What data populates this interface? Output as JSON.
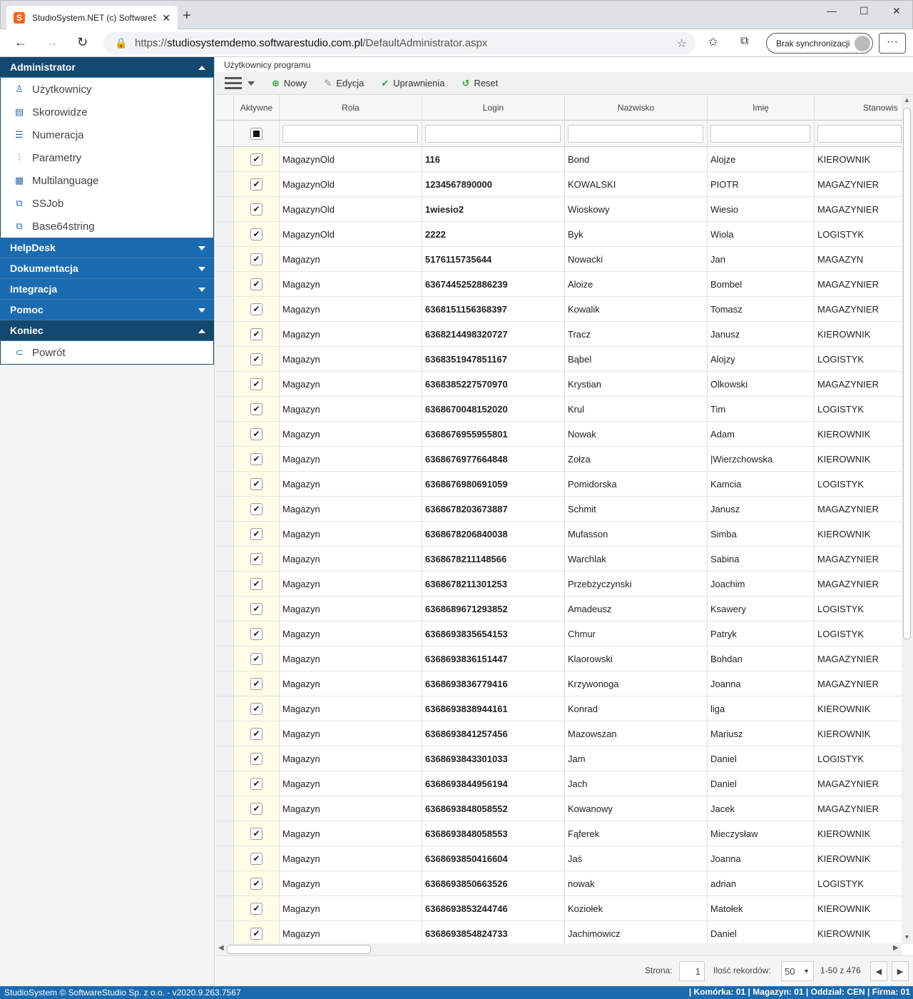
{
  "browser": {
    "tab_title": "StudioSystem.NET (c) SoftwareSt",
    "url_prefix": "https://",
    "url_host": "studiosystemdemo.softwarestudio.com.pl",
    "url_path": "/DefaultAdministrator.aspx",
    "sync_label": "Brak synchronizacji",
    "more_label": "···"
  },
  "sidebar": {
    "admin_label": "Administrator",
    "items": [
      {
        "label": "Użytkownicy",
        "icon": "user-icon",
        "glyph": "♙"
      },
      {
        "label": "Skorowidze",
        "icon": "book-icon",
        "glyph": "▤"
      },
      {
        "label": "Numeracja",
        "icon": "list-icon",
        "glyph": "☰"
      },
      {
        "label": "Parametry",
        "icon": "sliders-icon",
        "glyph": "⫶"
      },
      {
        "label": "Multilanguage",
        "icon": "document-icon",
        "glyph": "▦"
      },
      {
        "label": "SSJob",
        "icon": "job-icon",
        "glyph": "⧉"
      },
      {
        "label": "Base64string",
        "icon": "convert-icon",
        "glyph": "⧉"
      }
    ],
    "sections": [
      "HelpDesk",
      "Dokumentacja",
      "Integracja",
      "Pomoc"
    ],
    "end_label": "Koniec",
    "back_label": "Powrót"
  },
  "main": {
    "breadcrumb": "Użytkownicy programu",
    "toolbar": {
      "new": "Nowy",
      "edit": "Edycja",
      "perms": "Uprawnienia",
      "reset": "Reset"
    },
    "columns": {
      "active": "Aktywne",
      "role": "Rola",
      "login": "Login",
      "surname": "Nazwisko",
      "name": "Imię",
      "position": "Stanowis"
    },
    "rows": [
      [
        "MagazynOld",
        "116",
        "Bond",
        "Alojze",
        "KIEROWNIK"
      ],
      [
        "MagazynOld",
        "1234567890000",
        "KOWALSKI",
        "PIOTR",
        "MAGAZYNIER"
      ],
      [
        "MagazynOld",
        "1wiesio2",
        "Wioskowy",
        "Wiesio",
        "MAGAZYNIER"
      ],
      [
        "MagazynOld",
        "2222",
        "Byk",
        "Wiola",
        "LOGISTYK"
      ],
      [
        "Magazyn",
        "5176115735644",
        "Nowacki",
        "Jan",
        "MAGAZYN"
      ],
      [
        "Magazyn",
        "6367445252886239",
        "Aloize",
        "Bombel",
        "MAGAZYNIER"
      ],
      [
        "Magazyn",
        "6368151156368397",
        "Kowalik",
        "Tomasz",
        "MAGAZYNIER"
      ],
      [
        "Magazyn",
        "6368214498320727",
        "Tracz",
        "Janusz",
        "KIEROWNIK"
      ],
      [
        "Magazyn",
        "6368351947851167",
        "Bąbel",
        "Alojzy",
        "LOGISTYK"
      ],
      [
        "Magazyn",
        "6368385227570970",
        "Krystian",
        "Olkowski",
        "MAGAZYNIER"
      ],
      [
        "Magazyn",
        "6368670048152020",
        "Krul",
        "Tim",
        "LOGISTYK"
      ],
      [
        "Magazyn",
        "6368676955955801",
        "Nowak",
        "Adam",
        "KIEROWNIK"
      ],
      [
        "Magazyn",
        "6368676977664848",
        "Zołza",
        "|Wierzchowska",
        "KIEROWNIK"
      ],
      [
        "Magazyn",
        "6368676980691059",
        "Pomidorska",
        "Kamcia",
        "LOGISTYK"
      ],
      [
        "Magazyn",
        "6368678203673887",
        "Schmit",
        "Janusz",
        "MAGAZYNIER"
      ],
      [
        "Magazyn",
        "6368678206840038",
        "Mufasson",
        "Simba",
        "KIEROWNIK"
      ],
      [
        "Magazyn",
        "6368678211148566",
        "Warchlak",
        "Sabina",
        "MAGAZYNIER"
      ],
      [
        "Magazyn",
        "6368678211301253",
        "Przebżyczynski",
        "Joachim",
        "MAGAZYNIER"
      ],
      [
        "Magazyn",
        "6368689671293852",
        "Amadeusz",
        "Ksawery",
        "LOGISTYK"
      ],
      [
        "Magazyn",
        "6368693835654153",
        "Chmur",
        "Patryk",
        "LOGISTYK"
      ],
      [
        "Magazyn",
        "6368693836151447",
        "Klaorowski",
        "Bohdan",
        "MAGAZYNIER"
      ],
      [
        "Magazyn",
        "6368693836779416",
        "Krzywonoga",
        "Joanna",
        "MAGAZYNIER"
      ],
      [
        "Magazyn",
        "6368693838944161",
        "Konrad",
        "liga",
        "KIEROWNIK"
      ],
      [
        "Magazyn",
        "6368693841257456",
        "Mazowszan",
        "Mariusz",
        "KIEROWNIK"
      ],
      [
        "Magazyn",
        "6368693843301033",
        "Jam",
        "Daniel",
        "LOGISTYK"
      ],
      [
        "Magazyn",
        "6368693844956194",
        "Jach",
        "Daniel",
        "MAGAZYNIER"
      ],
      [
        "Magazyn",
        "6368693848058552",
        "Kowanowy",
        "Jacek",
        "MAGAZYNIER"
      ],
      [
        "Magazyn",
        "6368693848058553",
        "Fąferek",
        "Mieczysław",
        "KIEROWNIK"
      ],
      [
        "Magazyn",
        "6368693850416604",
        "Jaś",
        "Joanna",
        "KIEROWNIK"
      ],
      [
        "Magazyn",
        "6368693850663526",
        "nowak",
        "adrian",
        "LOGISTYK"
      ],
      [
        "Magazyn",
        "6368693853244746",
        "Koziołek",
        "Matołek",
        "KIEROWNIK"
      ],
      [
        "Magazyn",
        "6368693854824733",
        "Jachimowicz",
        "Daniel",
        "KIEROWNIK"
      ]
    ],
    "pager": {
      "page_label": "Strona:",
      "page_value": "1",
      "count_label": "Ilość rekordów:",
      "count_value": "50",
      "range": "1-50 z 476"
    }
  },
  "status": {
    "left": "StudioSystem © SoftwareStudio Sp. z o.o. - v2020.9.263.7567",
    "right": "| Komórka: 01 | Magazyn: 01 | Oddział: CEN | Firma: 01"
  }
}
